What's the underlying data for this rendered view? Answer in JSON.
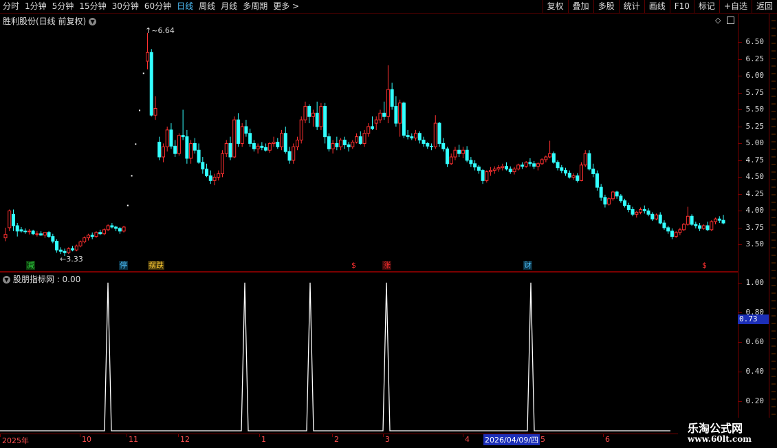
{
  "toolbar": {
    "periods": [
      "分时",
      "1分钟",
      "5分钟",
      "15分钟",
      "30分钟",
      "60分钟",
      "日线",
      "周线",
      "月线",
      "多周期",
      "更多 >"
    ],
    "active_period": "日线",
    "right_buttons": [
      "复权",
      "叠加",
      "多股",
      "统计",
      "画线",
      "F10",
      "标记",
      "+自选",
      "返回"
    ]
  },
  "main_pane": {
    "title": "胜利股份(日线 前复权)",
    "high_label": "6.64",
    "low_label": "3.33",
    "flags": [
      {
        "text": "减",
        "color": "#2ecc40",
        "bg": "#0b3d0b"
      },
      {
        "text": "停",
        "color": "#4fc3ff",
        "bg": "#0a2f40"
      },
      {
        "text": "摆跌",
        "color": "#ffcc33",
        "bg": "#3d300a"
      },
      {
        "text": "$",
        "color": "#ff3030",
        "bg": "#000"
      },
      {
        "text": "涨",
        "color": "#ff3030",
        "bg": "#3d0a0a"
      },
      {
        "text": "财",
        "color": "#4fc3ff",
        "bg": "#0a2f40"
      },
      {
        "text": "$",
        "color": "#ff3030",
        "bg": "#000"
      }
    ]
  },
  "indicator_pane": {
    "title": "股朋指标网 : 0.00",
    "current_marker": "0.73"
  },
  "x_axis": {
    "labels": [
      "2025年",
      "10",
      "11",
      "12",
      "1",
      "2",
      "3",
      "4",
      "5",
      "6"
    ],
    "selected_date": "2026/04/09/四"
  },
  "watermark": {
    "title": "乐淘公式网",
    "url": "www.60lt.com"
  },
  "colors": {
    "up": "#ff3030",
    "down": "#33ffff",
    "border": "#7a0000",
    "indicator_line": "#ffffff"
  },
  "chart_data": [
    {
      "type": "candlestick",
      "title": "胜利股份(日线 前复权)",
      "ylim": [
        3.3,
        6.75
      ],
      "yticks": [
        3.5,
        3.75,
        4.0,
        4.25,
        4.5,
        4.75,
        5.0,
        5.25,
        5.5,
        5.75,
        6.0,
        6.25,
        6.5
      ],
      "annotations": {
        "high": 6.64,
        "low": 3.33
      },
      "candles": [
        [
          3.6,
          3.75,
          3.55,
          3.65
        ],
        [
          3.75,
          4.02,
          3.7,
          4.0
        ],
        [
          3.95,
          4.02,
          3.7,
          3.78
        ],
        [
          3.78,
          3.82,
          3.62,
          3.7
        ],
        [
          3.72,
          3.76,
          3.68,
          3.7
        ],
        [
          3.7,
          3.74,
          3.66,
          3.69
        ],
        [
          3.69,
          3.73,
          3.65,
          3.7
        ],
        [
          3.7,
          3.72,
          3.64,
          3.66
        ],
        [
          3.66,
          3.7,
          3.62,
          3.66
        ],
        [
          3.66,
          3.7,
          3.63,
          3.64
        ],
        [
          3.64,
          3.68,
          3.6,
          3.68
        ],
        [
          3.68,
          3.7,
          3.6,
          3.62
        ],
        [
          3.62,
          3.66,
          3.52,
          3.55
        ],
        [
          3.55,
          3.58,
          3.38,
          3.42
        ],
        [
          3.42,
          3.46,
          3.36,
          3.4
        ],
        [
          3.4,
          3.44,
          3.33,
          3.38
        ],
        [
          3.38,
          3.46,
          3.36,
          3.44
        ],
        [
          3.44,
          3.48,
          3.4,
          3.42
        ],
        [
          3.42,
          3.5,
          3.4,
          3.48
        ],
        [
          3.48,
          3.56,
          3.46,
          3.54
        ],
        [
          3.54,
          3.62,
          3.52,
          3.6
        ],
        [
          3.6,
          3.66,
          3.56,
          3.64
        ],
        [
          3.64,
          3.68,
          3.58,
          3.62
        ],
        [
          3.62,
          3.7,
          3.6,
          3.68
        ],
        [
          3.68,
          3.72,
          3.64,
          3.66
        ],
        [
          3.66,
          3.74,
          3.64,
          3.72
        ],
        [
          3.72,
          3.8,
          3.7,
          3.78
        ],
        [
          3.78,
          3.82,
          3.74,
          3.76
        ],
        [
          3.76,
          3.78,
          3.7,
          3.74
        ],
        [
          3.74,
          3.76,
          3.66,
          3.7
        ],
        [
          3.7,
          3.78,
          3.68,
          3.76
        ],
        [
          4.08,
          4.08,
          4.08,
          4.08
        ],
        [
          4.52,
          4.52,
          4.52,
          4.52
        ],
        [
          4.99,
          4.99,
          4.99,
          4.99
        ],
        [
          5.49,
          5.49,
          5.49,
          5.49
        ],
        [
          6.04,
          6.04,
          6.04,
          6.04
        ],
        [
          6.22,
          6.64,
          6.1,
          6.35
        ],
        [
          6.35,
          6.4,
          5.4,
          5.42
        ],
        [
          5.42,
          5.7,
          5.35,
          5.52
        ],
        [
          5.02,
          5.1,
          4.75,
          4.8
        ],
        [
          4.8,
          5.0,
          4.72,
          4.95
        ],
        [
          4.95,
          5.25,
          4.88,
          5.2
        ],
        [
          5.2,
          5.3,
          4.92,
          4.96
        ],
        [
          4.96,
          5.05,
          4.8,
          4.85
        ],
        [
          4.85,
          5.15,
          4.82,
          5.12
        ],
        [
          5.12,
          5.5,
          5.05,
          5.1
        ],
        [
          5.1,
          5.2,
          4.7,
          4.78
        ],
        [
          4.78,
          5.05,
          4.7,
          5.0
        ],
        [
          5.0,
          5.08,
          4.85,
          4.9
        ],
        [
          4.9,
          5.0,
          4.7,
          4.72
        ],
        [
          4.72,
          4.8,
          4.55,
          4.62
        ],
        [
          4.62,
          4.7,
          4.5,
          4.52
        ],
        [
          4.52,
          4.6,
          4.4,
          4.45
        ],
        [
          4.45,
          4.55,
          4.38,
          4.5
        ],
        [
          4.5,
          4.6,
          4.45,
          4.55
        ],
        [
          4.55,
          4.9,
          4.5,
          4.85
        ],
        [
          4.85,
          5.05,
          4.8,
          5.0
        ],
        [
          5.0,
          5.1,
          4.75,
          4.8
        ],
        [
          4.8,
          5.4,
          4.78,
          5.35
        ],
        [
          5.35,
          5.45,
          4.95,
          5.0
        ],
        [
          5.0,
          5.3,
          4.95,
          5.25
        ],
        [
          5.25,
          5.35,
          5.1,
          5.15
        ],
        [
          5.15,
          5.22,
          4.95,
          5.0
        ],
        [
          5.0,
          5.05,
          4.88,
          4.92
        ],
        [
          4.92,
          5.0,
          4.85,
          4.96
        ],
        [
          4.96,
          5.02,
          4.9,
          4.94
        ],
        [
          4.94,
          5.0,
          4.88,
          4.9
        ],
        [
          4.9,
          5.02,
          4.86,
          5.0
        ],
        [
          5.0,
          5.1,
          4.95,
          5.02
        ],
        [
          5.02,
          5.08,
          4.92,
          4.95
        ],
        [
          4.95,
          5.2,
          4.9,
          5.15
        ],
        [
          5.15,
          5.25,
          4.85,
          4.88
        ],
        [
          4.88,
          4.95,
          4.7,
          4.75
        ],
        [
          4.75,
          5.0,
          4.7,
          4.95
        ],
        [
          4.95,
          5.1,
          4.9,
          5.05
        ],
        [
          5.05,
          5.4,
          5.0,
          5.35
        ],
        [
          5.35,
          5.62,
          5.3,
          5.55
        ],
        [
          5.55,
          5.58,
          5.3,
          5.4
        ],
        [
          5.4,
          5.5,
          5.25,
          5.45
        ],
        [
          5.45,
          5.62,
          5.2,
          5.25
        ],
        [
          5.25,
          5.6,
          5.2,
          5.55
        ],
        [
          5.55,
          5.6,
          5.0,
          5.1
        ],
        [
          5.1,
          5.15,
          4.88,
          4.92
        ],
        [
          4.92,
          5.05,
          4.85,
          5.0
        ],
        [
          5.0,
          5.1,
          4.9,
          4.95
        ],
        [
          4.95,
          5.08,
          4.9,
          5.05
        ],
        [
          5.05,
          5.1,
          4.92,
          4.98
        ],
        [
          4.98,
          5.02,
          4.88,
          4.95
        ],
        [
          4.95,
          5.05,
          4.92,
          5.02
        ],
        [
          5.02,
          5.15,
          5.0,
          5.1
        ],
        [
          5.1,
          5.18,
          4.98,
          5.0
        ],
        [
          5.0,
          5.2,
          4.95,
          5.15
        ],
        [
          5.15,
          5.3,
          5.1,
          5.25
        ],
        [
          5.25,
          5.4,
          5.2,
          5.22
        ],
        [
          5.3,
          5.4,
          5.2,
          5.35
        ],
        [
          5.35,
          5.5,
          5.3,
          5.45
        ],
        [
          5.45,
          5.62,
          5.35,
          5.4
        ],
        [
          5.4,
          6.16,
          5.3,
          5.8
        ],
        [
          5.8,
          5.9,
          5.5,
          5.55
        ],
        [
          5.55,
          5.7,
          5.25,
          5.3
        ],
        [
          5.3,
          5.65,
          5.1,
          5.6
        ],
        [
          5.6,
          5.62,
          5.08,
          5.12
        ],
        [
          5.12,
          5.2,
          5.06,
          5.1
        ],
        [
          5.1,
          5.15,
          5.05,
          5.08
        ],
        [
          5.08,
          5.2,
          5.04,
          5.15
        ],
        [
          5.15,
          5.18,
          5.0,
          5.05
        ],
        [
          5.05,
          5.1,
          4.95,
          5.0
        ],
        [
          5.0,
          5.02,
          4.92,
          4.96
        ],
        [
          4.96,
          5.0,
          4.9,
          4.95
        ],
        [
          4.95,
          5.42,
          4.92,
          5.3
        ],
        [
          5.3,
          5.32,
          4.95,
          5.0
        ],
        [
          5.0,
          5.08,
          4.88,
          4.92
        ],
        [
          4.92,
          4.95,
          4.65,
          4.7
        ],
        [
          4.7,
          4.85,
          4.68,
          4.8
        ],
        [
          4.8,
          4.95,
          4.75,
          4.9
        ],
        [
          4.9,
          4.98,
          4.8,
          4.85
        ],
        [
          4.85,
          4.95,
          4.78,
          4.9
        ],
        [
          4.9,
          4.96,
          4.72,
          4.75
        ],
        [
          4.75,
          4.8,
          4.65,
          4.7
        ],
        [
          4.7,
          4.75,
          4.6,
          4.65
        ],
        [
          4.65,
          4.68,
          4.55,
          4.6
        ],
        [
          4.6,
          4.62,
          4.4,
          4.45
        ],
        [
          4.45,
          4.6,
          4.42,
          4.58
        ],
        [
          4.58,
          4.65,
          4.52,
          4.6
        ],
        [
          4.6,
          4.66,
          4.55,
          4.62
        ],
        [
          4.62,
          4.68,
          4.58,
          4.64
        ],
        [
          4.64,
          4.7,
          4.6,
          4.66
        ],
        [
          4.66,
          4.72,
          4.6,
          4.62
        ],
        [
          4.62,
          4.66,
          4.55,
          4.58
        ],
        [
          4.58,
          4.65,
          4.54,
          4.62
        ],
        [
          4.62,
          4.7,
          4.6,
          4.68
        ],
        [
          4.68,
          4.72,
          4.62,
          4.66
        ],
        [
          4.66,
          4.74,
          4.64,
          4.72
        ],
        [
          4.72,
          4.78,
          4.66,
          4.7
        ],
        [
          4.7,
          4.74,
          4.62,
          4.66
        ],
        [
          4.66,
          4.72,
          4.6,
          4.7
        ],
        [
          4.7,
          4.78,
          4.68,
          4.76
        ],
        [
          4.76,
          4.82,
          4.72,
          4.8
        ],
        [
          4.8,
          5.04,
          4.78,
          4.85
        ],
        [
          4.85,
          4.88,
          4.7,
          4.72
        ],
        [
          4.72,
          4.75,
          4.6,
          4.64
        ],
        [
          4.64,
          4.68,
          4.56,
          4.6
        ],
        [
          4.6,
          4.64,
          4.52,
          4.56
        ],
        [
          4.56,
          4.6,
          4.48,
          4.5
        ],
        [
          4.5,
          4.56,
          4.46,
          4.52
        ],
        [
          4.52,
          4.56,
          4.42,
          4.45
        ],
        [
          4.45,
          4.72,
          4.44,
          4.68
        ],
        [
          4.68,
          4.9,
          4.65,
          4.85
        ],
        [
          4.85,
          4.9,
          4.6,
          4.62
        ],
        [
          4.62,
          4.7,
          4.5,
          4.55
        ],
        [
          4.55,
          4.6,
          4.3,
          4.35
        ],
        [
          4.35,
          4.4,
          4.15,
          4.2
        ],
        [
          4.2,
          4.24,
          4.05,
          4.1
        ],
        [
          4.1,
          4.2,
          4.08,
          4.18
        ],
        [
          4.18,
          4.3,
          4.15,
          4.28
        ],
        [
          4.28,
          4.3,
          4.18,
          4.22
        ],
        [
          4.22,
          4.25,
          4.12,
          4.15
        ],
        [
          4.15,
          4.18,
          4.05,
          4.08
        ],
        [
          4.08,
          4.12,
          3.98,
          4.02
        ],
        [
          4.02,
          4.06,
          3.92,
          3.95
        ],
        [
          3.95,
          4.0,
          3.9,
          3.98
        ],
        [
          3.98,
          4.05,
          3.95,
          4.02
        ],
        [
          4.02,
          4.08,
          3.96,
          4.0
        ],
        [
          4.0,
          4.04,
          3.92,
          3.95
        ],
        [
          3.95,
          3.98,
          3.85,
          3.88
        ],
        [
          3.88,
          3.96,
          3.86,
          3.94
        ],
        [
          3.94,
          3.98,
          3.8,
          3.82
        ],
        [
          3.82,
          3.86,
          3.72,
          3.75
        ],
        [
          3.75,
          3.78,
          3.66,
          3.7
        ],
        [
          3.7,
          3.74,
          3.58,
          3.62
        ],
        [
          3.62,
          3.7,
          3.6,
          3.68
        ],
        [
          3.68,
          3.75,
          3.64,
          3.72
        ],
        [
          3.72,
          3.82,
          3.7,
          3.8
        ],
        [
          3.8,
          4.06,
          3.78,
          3.92
        ],
        [
          3.92,
          3.95,
          3.78,
          3.8
        ],
        [
          3.8,
          3.84,
          3.74,
          3.78
        ],
        [
          3.78,
          3.82,
          3.7,
          3.74
        ],
        [
          3.74,
          3.8,
          3.72,
          3.78
        ],
        [
          3.78,
          3.84,
          3.7,
          3.72
        ],
        [
          3.72,
          3.86,
          3.7,
          3.84
        ],
        [
          3.84,
          3.9,
          3.8,
          3.88
        ],
        [
          3.88,
          3.92,
          3.82,
          3.86
        ],
        [
          3.86,
          3.94,
          3.8,
          3.82
        ]
      ]
    },
    {
      "type": "line",
      "title": "股朋指标网",
      "ylim": [
        0,
        1.05
      ],
      "yticks": [
        0.2,
        0.4,
        0.6,
        0.8,
        1.0
      ],
      "current_value": 0.73,
      "spike_positions": [
        157,
        356,
        451,
        562,
        772
      ],
      "spike_value": 1.0,
      "baseline": 0.0
    }
  ]
}
